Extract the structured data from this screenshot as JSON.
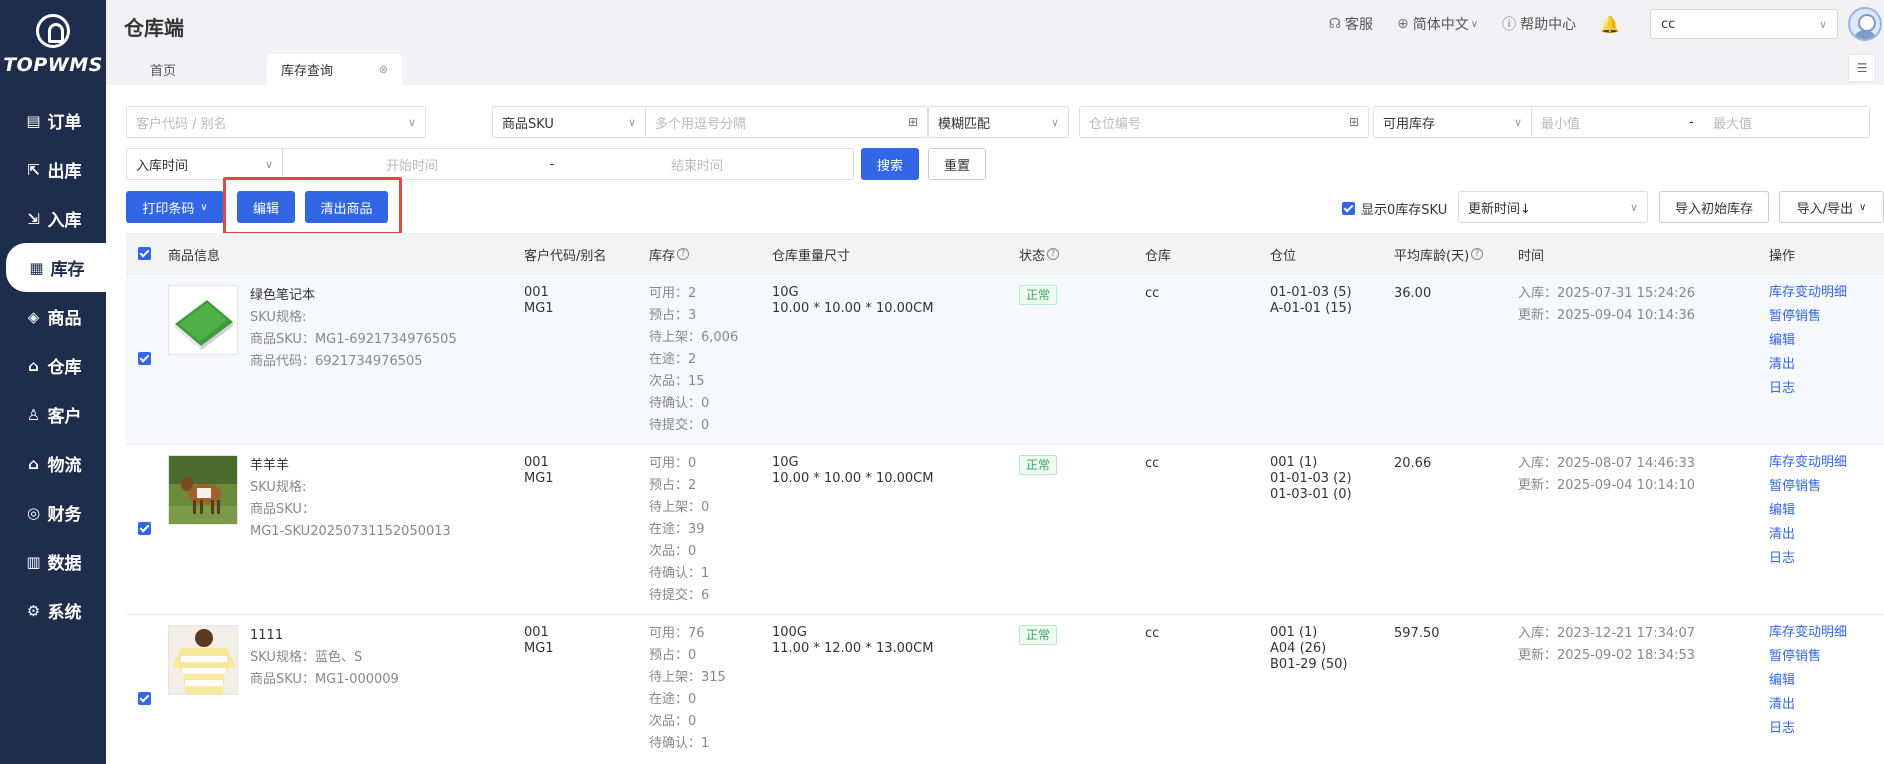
{
  "app": {
    "logo_text": "TOPWMS",
    "header_title": "仓库端"
  },
  "sidebar": {
    "items": [
      {
        "label": "订单",
        "icon": "list-icon",
        "glyph": "▤"
      },
      {
        "label": "出库",
        "icon": "outbound-icon",
        "glyph": "⇱"
      },
      {
        "label": "入库",
        "icon": "inbound-icon",
        "glyph": "⇲"
      },
      {
        "label": "库存",
        "icon": "inventory-icon",
        "glyph": "▦",
        "active": true
      },
      {
        "label": "商品",
        "icon": "bag-icon",
        "glyph": "◈"
      },
      {
        "label": "仓库",
        "icon": "warehouse-icon",
        "glyph": "⌂"
      },
      {
        "label": "客户",
        "icon": "user-icon",
        "glyph": "♙"
      },
      {
        "label": "物流",
        "icon": "truck-icon",
        "glyph": "⌂"
      },
      {
        "label": "财务",
        "icon": "finance-icon",
        "glyph": "◎"
      },
      {
        "label": "数据",
        "icon": "chart-icon",
        "glyph": "▥"
      },
      {
        "label": "系统",
        "icon": "gear-icon",
        "glyph": "⚙"
      }
    ]
  },
  "header": {
    "service": "客服",
    "language": "简体中文",
    "help": "帮助中心",
    "warehouse_select": "cc"
  },
  "tabs": {
    "home": "首页",
    "active": "库存查询"
  },
  "filters": {
    "customer_placeholder": "客户代码 / 别名",
    "sku_type": "商品SKU",
    "sku_placeholder": "多个用逗号分隔",
    "match_mode": "模糊匹配",
    "location_placeholder": "仓位编号",
    "stock_type": "可用库存",
    "min_placeholder": "最小值",
    "range_sep": "-",
    "max_placeholder": "最大值",
    "date_type": "入库时间",
    "start_placeholder": "开始时间",
    "end_placeholder": "结束时间",
    "search_label": "搜索",
    "reset_label": "重置"
  },
  "toolbar": {
    "print_label": "打印条码",
    "edit_label": "编辑",
    "clear_label": "清出商品",
    "show_zero_label": "显示0库存SKU",
    "sort_label": "更新时间↓",
    "import_initial_label": "导入初始库存",
    "import_export_label": "导入/导出"
  },
  "table": {
    "headers": {
      "product": "商品信息",
      "customer": "客户代码/别名",
      "stock": "库存",
      "weight": "仓库重量尺寸",
      "status": "状态",
      "warehouse": "仓库",
      "location": "仓位",
      "age": "平均库龄(天)",
      "time": "时间",
      "actions": "操作"
    },
    "ops": [
      "库存变动明细",
      "暂停销售",
      "编辑",
      "清出",
      "日志"
    ],
    "rows": [
      {
        "name": "绿色笔记本",
        "sku_spec": "SKU规格:",
        "sku_line1": "商品SKU：MG1-6921734976505",
        "sku_line2": "",
        "code": "商品代码：6921734976505",
        "customer_code": "001",
        "customer_alias": "MG1",
        "stock": [
          "可用：2",
          "预占：3",
          "待上架：6,006",
          "在途：2",
          "次品：15",
          "待确认：0",
          "待提交：0"
        ],
        "weight": "10G",
        "size": "10.00 * 10.00 * 10.00CM",
        "status": "正常",
        "warehouse": "cc",
        "locations": [
          "01-01-03 (5)",
          "A-01-01 (15)"
        ],
        "age": "36.00",
        "in_time": "入库：2025-07-31 15:24:26",
        "update_time": "更新：2025-09-04 10:14:36",
        "thumb": "notebook"
      },
      {
        "name": "羊羊羊",
        "sku_spec": "SKU规格:",
        "sku_line1": "商品SKU：",
        "sku_line2": "MG1-SKU20250731152050013",
        "code": "",
        "customer_code": "001",
        "customer_alias": "MG1",
        "stock": [
          "可用：0",
          "预占：2",
          "待上架：0",
          "在途：39",
          "次品：0",
          "待确认：1",
          "待提交：6"
        ],
        "weight": "10G",
        "size": "10.00 * 10.00 * 10.00CM",
        "status": "正常",
        "warehouse": "cc",
        "locations": [
          "001 (1)",
          "01-01-03 (2)",
          "01-03-01 (0)"
        ],
        "age": "20.66",
        "in_time": "入库：2025-08-07 14:46:33",
        "update_time": "更新：2025-09-04 10:14:10",
        "thumb": "goat"
      },
      {
        "name": "1111",
        "sku_spec": "SKU规格：蓝色、S",
        "sku_line1": "商品SKU：MG1-000009",
        "sku_line2": "",
        "code": "",
        "customer_code": "001",
        "customer_alias": "MG1",
        "stock": [
          "可用：76",
          "预占：0",
          "待上架：315",
          "在途：0",
          "次品：0",
          "待确认：1"
        ],
        "weight": "100G",
        "size": "11.00 * 12.00 * 13.00CM",
        "status": "正常",
        "warehouse": "cc",
        "locations": [
          "001 (1)",
          "A04 (26)",
          "B01-29 (50)"
        ],
        "age": "597.50",
        "in_time": "入库：2023-12-21 17:34:07",
        "update_time": "更新：2025-09-02 18:34:53",
        "thumb": "shirt"
      }
    ]
  }
}
